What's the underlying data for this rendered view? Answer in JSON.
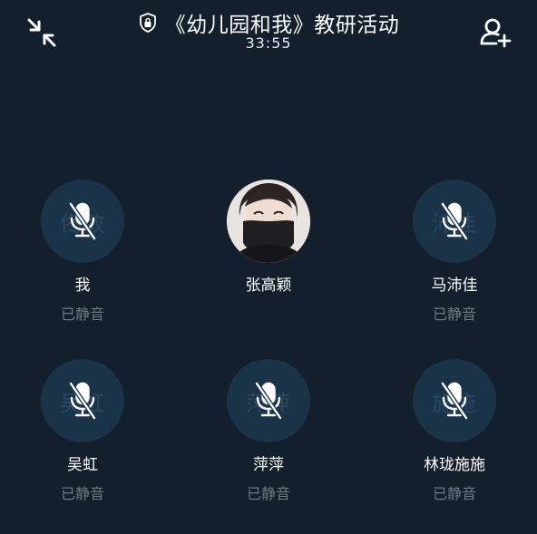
{
  "header": {
    "title": "《幼儿园和我》教研活动",
    "timer": "33:55"
  },
  "participants": [
    {
      "name": "我",
      "avatar_text": "佟敏",
      "status": "已静音",
      "avatar_type": "muted-mic"
    },
    {
      "name": "张高颖",
      "avatar_text": "",
      "status": "",
      "avatar_type": "photo"
    },
    {
      "name": "马沛佳",
      "avatar_text": "沛佳",
      "status": "已静音",
      "avatar_type": "muted-mic"
    },
    {
      "name": "吴虹",
      "avatar_text": "吴虹",
      "status": "已静音",
      "avatar_type": "muted-mic"
    },
    {
      "name": "萍萍",
      "avatar_text": "萍萍",
      "status": "已静音",
      "avatar_type": "muted-mic"
    },
    {
      "name": "林珑施施",
      "avatar_text": "施施",
      "status": "已静音",
      "avatar_type": "muted-mic"
    }
  ],
  "icons": {
    "minimize": "minimize-icon",
    "add_member": "add-member-icon",
    "lock": "lock-shield-icon",
    "muted_mic": "mic-muted-icon"
  },
  "colors": {
    "background": "#131f2c",
    "avatar_bg": "#1a3349",
    "status_text": "#6f7a85"
  }
}
